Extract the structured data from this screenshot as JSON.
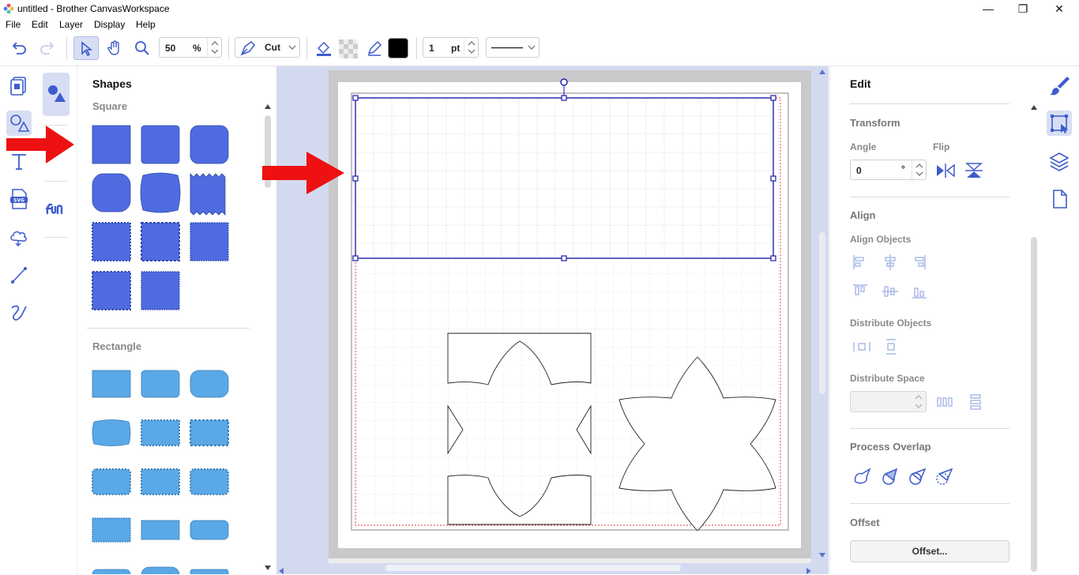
{
  "window": {
    "title": "untitled - Brother CanvasWorkspace",
    "minimize": "—",
    "maximize": "❐",
    "close": "✕"
  },
  "menu": [
    "File",
    "Edit",
    "Layer",
    "Display",
    "Help"
  ],
  "toolbar": {
    "zoom_value": "50",
    "zoom_unit": "%",
    "mode_label": "Cut",
    "line_width_value": "1",
    "line_width_unit": "pt",
    "line_color": "#000000"
  },
  "shapes_panel": {
    "title": "Shapes",
    "section_square": "Square",
    "section_rectangle": "Rectangle",
    "square_color": "#4f6be0",
    "rect_color": "#5aa8e6"
  },
  "edit_panel": {
    "title": "Edit",
    "transform": "Transform",
    "angle_label": "Angle",
    "flip_label": "Flip",
    "angle_value": "0",
    "angle_unit": "°",
    "align": "Align",
    "align_objects": "Align Objects",
    "distribute_objects": "Distribute Objects",
    "distribute_space": "Distribute Space",
    "process_overlap": "Process Overlap",
    "offset": "Offset",
    "offset_button": "Offset..."
  },
  "colors": {
    "accent": "#3d5ccc",
    "selection": "#1a1aaa",
    "annotation_arrow": "#ee1111"
  }
}
